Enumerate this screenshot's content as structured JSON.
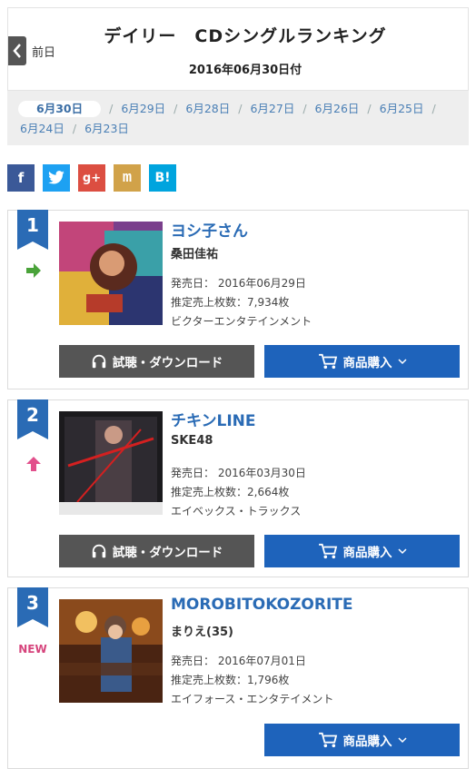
{
  "header": {
    "back_label": "前日",
    "title": "デイリー　CDシングルランキング",
    "date": "2016年06月30日付"
  },
  "dates": [
    "6月30日",
    "6月29日",
    "6月28日",
    "6月27日",
    "6月26日",
    "6月25日",
    "6月24日",
    "6月23日"
  ],
  "social": [
    {
      "name": "facebook",
      "label": "f",
      "color": "#3b5998"
    },
    {
      "name": "twitter",
      "label": "t",
      "color": "#1da1f2"
    },
    {
      "name": "google-plus",
      "label": "g+",
      "color": "#dc4e41"
    },
    {
      "name": "mixi",
      "label": "m",
      "color": "#d1a249"
    },
    {
      "name": "hatena",
      "label": "B!",
      "color": "#00a4de"
    }
  ],
  "labels": {
    "release": "発売日：",
    "sales": "推定売上枚数：",
    "listen": "試聴・ダウンロード",
    "buy": "商品購入"
  },
  "entries": [
    {
      "rank": "1",
      "trend": "same",
      "title": "ヨシ子さん",
      "artist": "桑田佳祐",
      "release_date": "2016年06月29日",
      "sales": "7,934枚",
      "label": "ビクターエンタテインメント",
      "has_listen": true
    },
    {
      "rank": "2",
      "trend": "up",
      "title": "チキンLINE",
      "artist": "SKE48",
      "release_date": "2016年03月30日",
      "sales": "2,664枚",
      "label": "エイベックス・トラックス",
      "has_listen": true
    },
    {
      "rank": "3",
      "trend": "new",
      "trend_text": "NEW",
      "title": "MOROBITOKOZORITE",
      "artist": "まりえ(35)",
      "release_date": "2016年07月01日",
      "sales": "1,796枚",
      "label": "エイフォース・エンタテイメント",
      "has_listen": false
    }
  ],
  "colors": {
    "badge": "#2a6bb5",
    "trend_same": "#4aa33a",
    "trend_up": "#e2508c",
    "trend_new": "#d6447c"
  }
}
